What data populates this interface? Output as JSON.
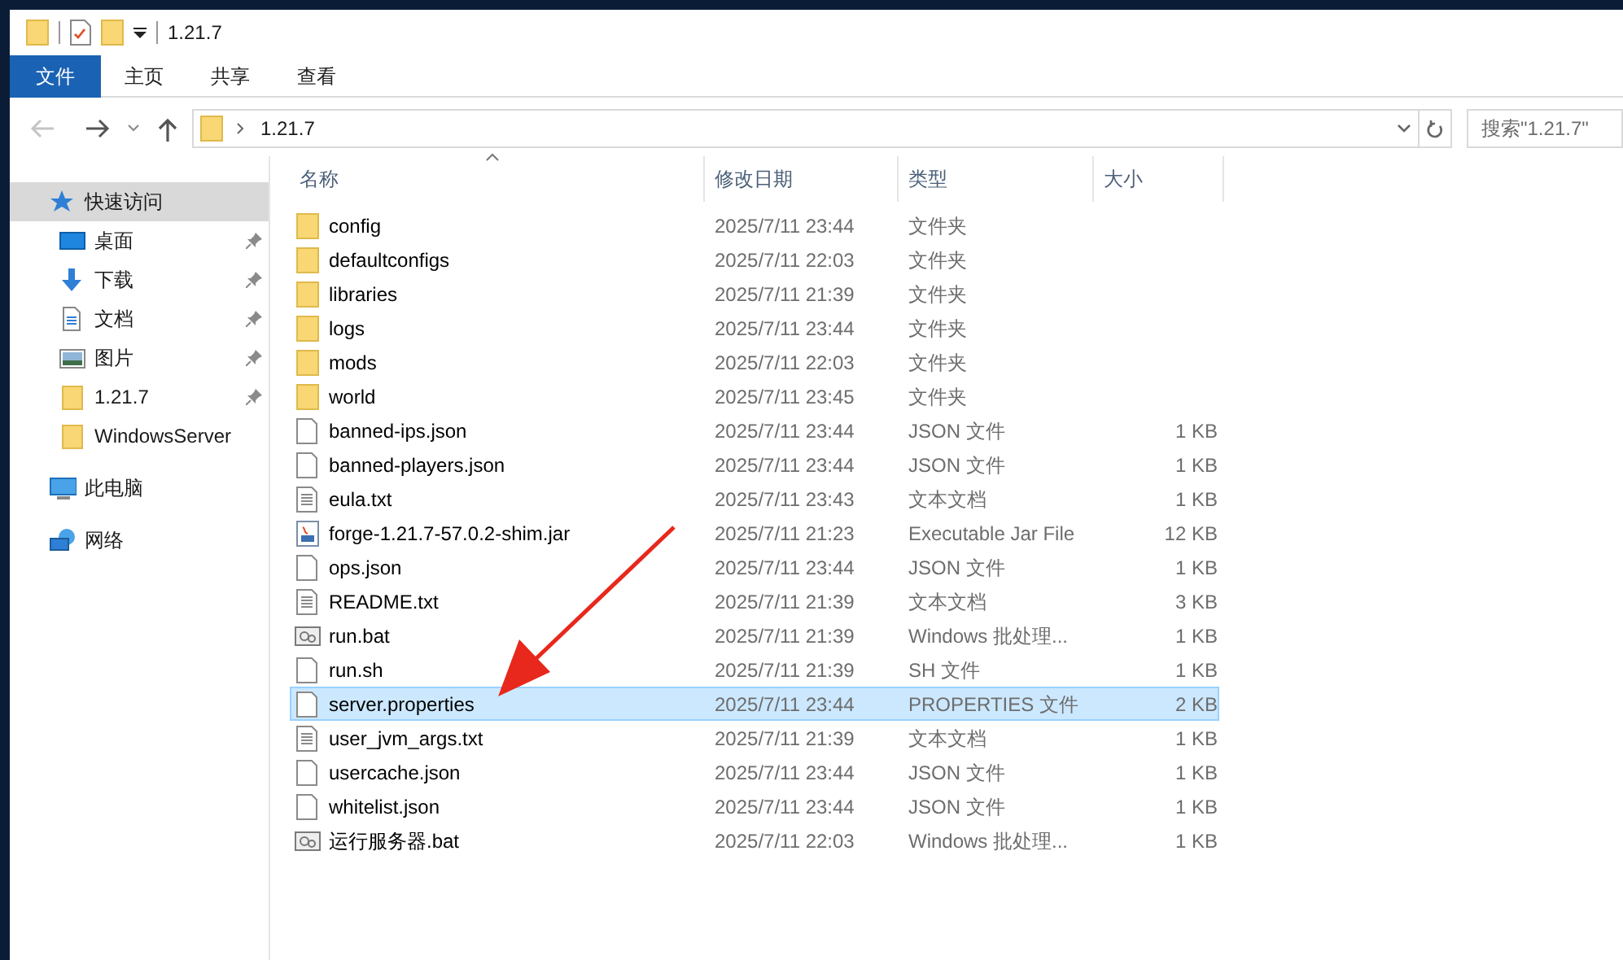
{
  "window": {
    "title": "1.21.7"
  },
  "ribbon_tabs": [
    {
      "label": "文件",
      "selected": true
    },
    {
      "label": "主页",
      "selected": false
    },
    {
      "label": "共享",
      "selected": false
    },
    {
      "label": "查看",
      "selected": false
    }
  ],
  "address_bar": {
    "path": "1.21.7"
  },
  "search": {
    "placeholder": "搜索\"1.21.7\""
  },
  "sidebar": {
    "items": [
      {
        "label": "快速访问",
        "kind": "star",
        "selected": true,
        "children": [
          {
            "label": "桌面",
            "kind": "desktop",
            "selected": false,
            "pinned": true
          },
          {
            "label": "下载",
            "kind": "download",
            "selected": false,
            "pinned": true
          },
          {
            "label": "文档",
            "kind": "document",
            "selected": false,
            "pinned": true
          },
          {
            "label": "图片",
            "kind": "pictures",
            "selected": false,
            "pinned": true
          },
          {
            "label": "1.21.7",
            "kind": "folder",
            "selected": false,
            "pinned": true
          },
          {
            "label": "WindowsServer",
            "kind": "folder",
            "selected": false,
            "pinned": false
          }
        ]
      },
      {
        "label": "此电脑",
        "kind": "computer",
        "selected": false
      },
      {
        "label": "网络",
        "kind": "network",
        "selected": false
      }
    ]
  },
  "table": {
    "columns": [
      "名称",
      "修改日期",
      "类型",
      "大小"
    ],
    "rows": [
      {
        "kind": "folder",
        "name": "config",
        "date": "2025/7/11 23:44",
        "type": "文件夹",
        "selected": false
      },
      {
        "kind": "folder",
        "name": "defaultconfigs",
        "date": "2025/7/11 22:03",
        "type": "文件夹",
        "selected": false
      },
      {
        "kind": "folder",
        "name": "libraries",
        "date": "2025/7/11 21:39",
        "type": "文件夹",
        "selected": false
      },
      {
        "kind": "folder",
        "name": "logs",
        "date": "2025/7/11 23:44",
        "type": "文件夹",
        "selected": false
      },
      {
        "kind": "folder",
        "name": "mods",
        "date": "2025/7/11 22:03",
        "type": "文件夹",
        "selected": false
      },
      {
        "kind": "folder",
        "name": "world",
        "date": "2025/7/11 23:45",
        "type": "文件夹",
        "selected": false
      },
      {
        "kind": "file",
        "name": "banned-ips.json",
        "date": "2025/7/11 23:44",
        "type": "JSON 文件",
        "size": "1 KB",
        "selected": false
      },
      {
        "kind": "file",
        "name": "banned-players.json",
        "date": "2025/7/11 23:44",
        "type": "JSON 文件",
        "size": "1 KB",
        "selected": false
      },
      {
        "kind": "text",
        "name": "eula.txt",
        "date": "2025/7/11 23:43",
        "type": "文本文档",
        "size": "1 KB",
        "selected": false
      },
      {
        "kind": "jar",
        "name": "forge-1.21.7-57.0.2-shim.jar",
        "date": "2025/7/11 21:23",
        "type": "Executable Jar File",
        "size": "12 KB",
        "selected": false
      },
      {
        "kind": "file",
        "name": "ops.json",
        "date": "2025/7/11 23:44",
        "type": "JSON 文件",
        "size": "1 KB",
        "selected": false
      },
      {
        "kind": "text",
        "name": "README.txt",
        "date": "2025/7/11 21:39",
        "type": "文本文档",
        "size": "3 KB",
        "selected": false
      },
      {
        "kind": "batch",
        "name": "run.bat",
        "date": "2025/7/11 21:39",
        "type": "Windows 批处理...",
        "size": "1 KB",
        "selected": false
      },
      {
        "kind": "file",
        "name": "run.sh",
        "date": "2025/7/11 21:39",
        "type": "SH 文件",
        "size": "1 KB",
        "selected": false
      },
      {
        "kind": "file",
        "name": "server.properties",
        "date": "2025/7/11 23:44",
        "type": "PROPERTIES 文件",
        "size": "2 KB",
        "selected": true
      },
      {
        "kind": "text",
        "name": "user_jvm_args.txt",
        "date": "2025/7/11 21:39",
        "type": "文本文档",
        "size": "1 KB",
        "selected": false
      },
      {
        "kind": "file",
        "name": "usercache.json",
        "date": "2025/7/11 23:44",
        "type": "JSON 文件",
        "size": "1 KB",
        "selected": false
      },
      {
        "kind": "file",
        "name": "whitelist.json",
        "date": "2025/7/11 23:44",
        "type": "JSON 文件",
        "size": "1 KB",
        "selected": false
      },
      {
        "kind": "batch",
        "name": "运行服务器.bat",
        "date": "2025/7/11 22:03",
        "type": "Windows 批处理...",
        "size": "1 KB",
        "selected": false
      }
    ]
  },
  "annotation": {
    "kind": "arrow"
  }
}
